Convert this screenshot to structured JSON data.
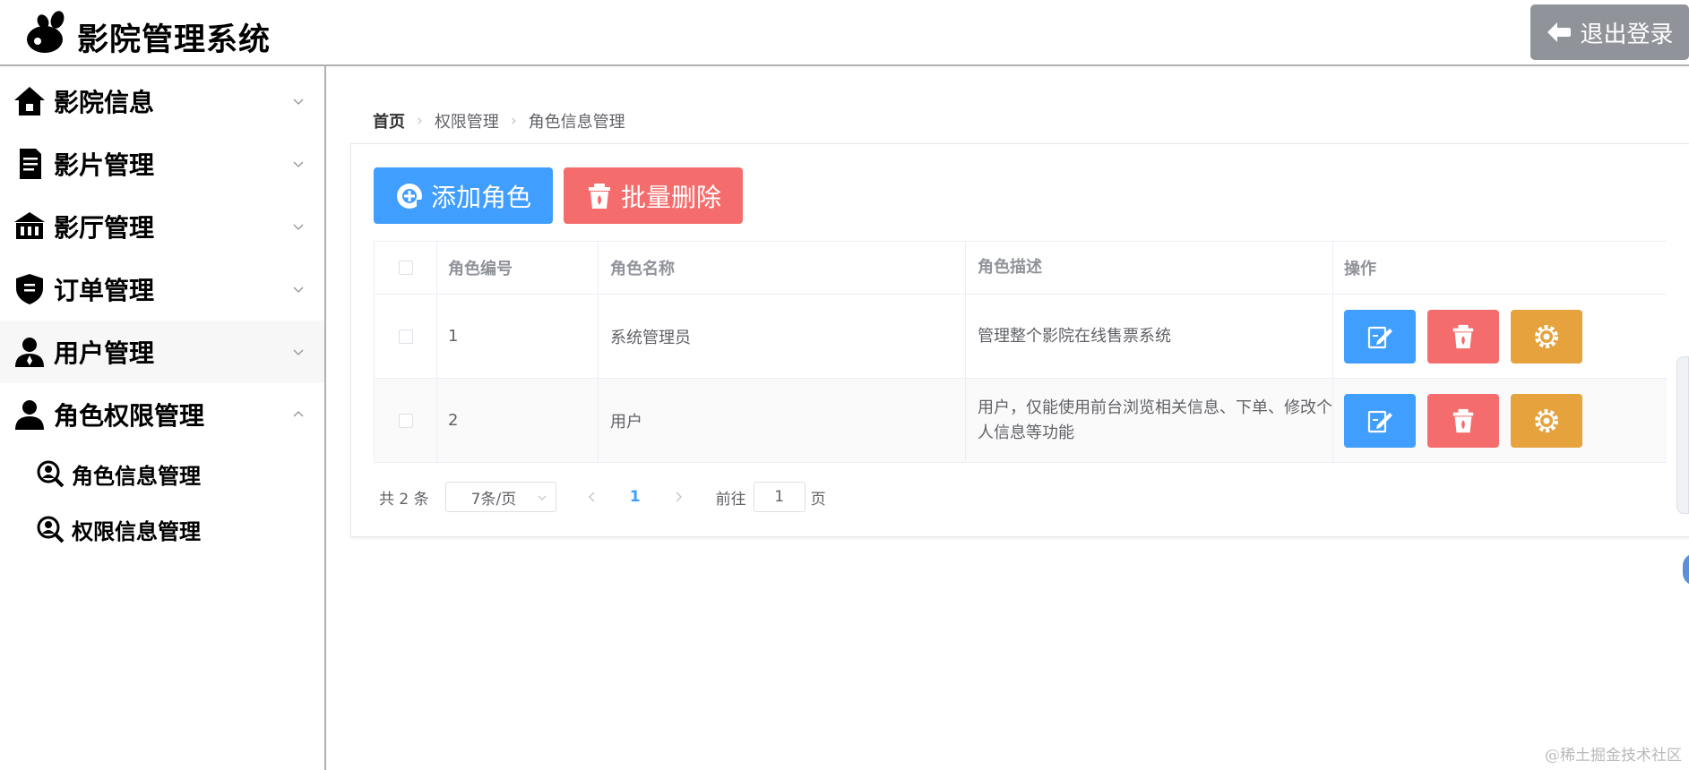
{
  "header": {
    "title": "影院管理系统",
    "logout_label": "退出登录"
  },
  "sidebar": {
    "items": [
      {
        "label": "影院信息",
        "icon": "home-icon",
        "expanded": false
      },
      {
        "label": "影片管理",
        "icon": "document-icon",
        "expanded": false
      },
      {
        "label": "影厅管理",
        "icon": "bank-icon",
        "expanded": false
      },
      {
        "label": "订单管理",
        "icon": "shield-icon",
        "expanded": false
      },
      {
        "label": "用户管理",
        "icon": "user-icon",
        "expanded": false
      },
      {
        "label": "角色权限管理",
        "icon": "user-icon",
        "expanded": true
      }
    ],
    "sub_items": [
      {
        "label": "角色信息管理",
        "icon": "search-user-icon"
      },
      {
        "label": "权限信息管理",
        "icon": "search-user-icon"
      }
    ]
  },
  "breadcrumb": [
    "首页",
    "权限管理",
    "角色信息管理"
  ],
  "toolbar": {
    "add_label": "添加角色",
    "batch_delete_label": "批量删除"
  },
  "table": {
    "columns": [
      "角色编号",
      "角色名称",
      "角色描述",
      "操作"
    ],
    "rows": [
      {
        "id": "1",
        "name": "系统管理员",
        "description": "管理整个影院在线售票系统"
      },
      {
        "id": "2",
        "name": "用户",
        "description": "用户，仅能使用前台浏览相关信息、下单、修改个人信息等功能"
      }
    ]
  },
  "pagination": {
    "total_text": "共 2 条",
    "page_size": "7条/页",
    "current_page": "1",
    "goto_label": "前往",
    "goto_value": "1",
    "goto_suffix": "页"
  },
  "watermark": "@稀土掘金技术社区",
  "colors": {
    "primary": "#409eff",
    "danger": "#f56c6c",
    "warning": "#e6a23c",
    "info": "#909399"
  }
}
